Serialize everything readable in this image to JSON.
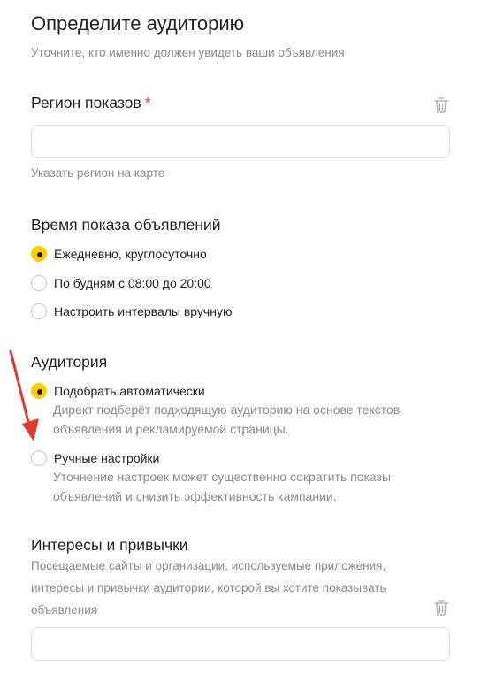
{
  "header": {
    "title": "Определите аудиторию",
    "subtitle": "Уточните, кто именно должен увидеть ваши объявления"
  },
  "region": {
    "label": "Регион показов",
    "required_mark": "*",
    "input_value": "",
    "map_link": "Указать регион на карте"
  },
  "schedule": {
    "label": "Время показа объявлений",
    "options": [
      {
        "label": "Ежедневно, круглосуточно",
        "selected": true
      },
      {
        "label": "По будням с 08:00 до 20:00",
        "selected": false
      },
      {
        "label": "Настроить интервалы вручную",
        "selected": false
      }
    ]
  },
  "audience": {
    "label": "Аудитория",
    "options": [
      {
        "label": "Подобрать автоматически",
        "selected": true,
        "desc_line1": "Директ подберёт подходящую аудиторию на основе текстов",
        "desc_line2": "объявления и рекламируемой страницы."
      },
      {
        "label": "Ручные настройки",
        "selected": false,
        "desc_line1": "Уточнение настроек может существенно сократить показы",
        "desc_line2": "объявлений и снизить эффективность кампании."
      }
    ]
  },
  "interests": {
    "label": "Интересы и привычки",
    "desc_line1": "Посещаемые сайты и организации, используемые приложения,",
    "desc_line2": "интересы и привычки аудитории, которой вы хотите показывать",
    "desc_line3": "объявления",
    "input_value": ""
  },
  "colors": {
    "accent": "#ffcc00",
    "required": "#e8392d",
    "arrow": "#e03a2f"
  },
  "icons": {
    "delete": "trash-icon",
    "annotation": "red-arrow"
  }
}
